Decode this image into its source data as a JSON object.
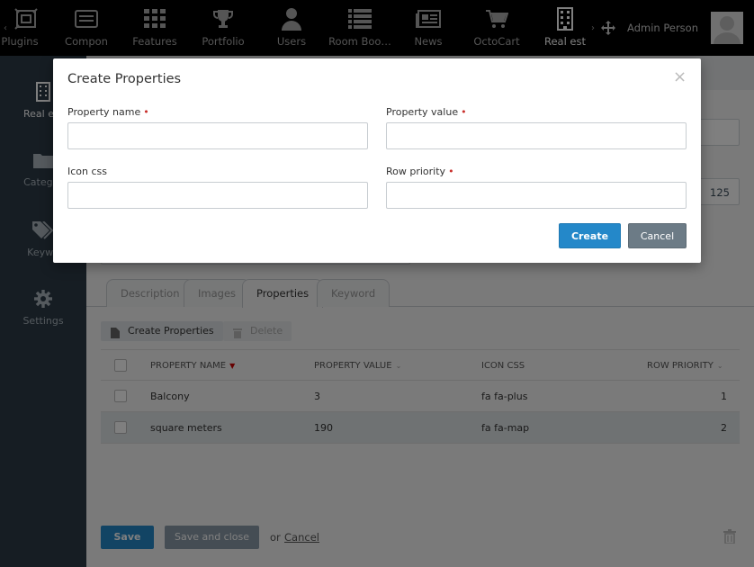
{
  "topnav": {
    "items": [
      {
        "label": "Plugins",
        "icon": "plugins-icon"
      },
      {
        "label": "Compon",
        "icon": "components-icon"
      },
      {
        "label": "Features",
        "icon": "features-grid-icon"
      },
      {
        "label": "Portfolio",
        "icon": "trophy-icon"
      },
      {
        "label": "Users",
        "icon": "user-icon"
      },
      {
        "label": "Room Boo…",
        "icon": "list-icon"
      },
      {
        "label": "News",
        "icon": "newspaper-icon"
      },
      {
        "label": "OctoCart",
        "icon": "cart-icon"
      },
      {
        "label": "Real est",
        "icon": "building-icon"
      }
    ],
    "user_name": "Admin Person"
  },
  "sidenav": {
    "items": [
      {
        "label": "Real est",
        "icon": "building-icon"
      },
      {
        "label": "Categor",
        "icon": "folder-icon"
      },
      {
        "label": "Keywo",
        "icon": "tags-icon"
      },
      {
        "label": "Settings",
        "icon": "gear-icon"
      }
    ]
  },
  "form": {
    "bg_value": "125"
  },
  "tabs": [
    "Description",
    "Images",
    "Properties",
    "Keyword"
  ],
  "toolbar": {
    "create_label": "Create Properties",
    "delete_label": "Delete"
  },
  "grid": {
    "columns": [
      "PROPERTY NAME",
      "PROPERTY VALUE",
      "ICON CSS",
      "ROW PRIORITY"
    ],
    "rows": [
      {
        "name": "Balcony",
        "value": "3",
        "icon": "fa fa-plus",
        "priority": "1"
      },
      {
        "name": "square meters",
        "value": "190",
        "icon": "fa fa-map",
        "priority": "2"
      }
    ]
  },
  "footer": {
    "save_label": "Save",
    "save_close_label": "Save and close",
    "or_text": "or",
    "cancel_label": "Cancel"
  },
  "modal": {
    "title": "Create Properties",
    "close_glyph": "×",
    "fields": {
      "property_name": {
        "label": "Property name",
        "value": "",
        "required": true
      },
      "property_value": {
        "label": "Property value",
        "value": "",
        "required": true
      },
      "icon_css": {
        "label": "Icon css",
        "value": "",
        "required": false
      },
      "row_priority": {
        "label": "Row priority",
        "value": "",
        "required": true
      }
    },
    "required_mark": "•",
    "create_label": "Create",
    "cancel_label": "Cancel"
  },
  "colors": {
    "primary": "#2488c9",
    "sidebar": "#2c3a46",
    "required": "#c9302c"
  }
}
